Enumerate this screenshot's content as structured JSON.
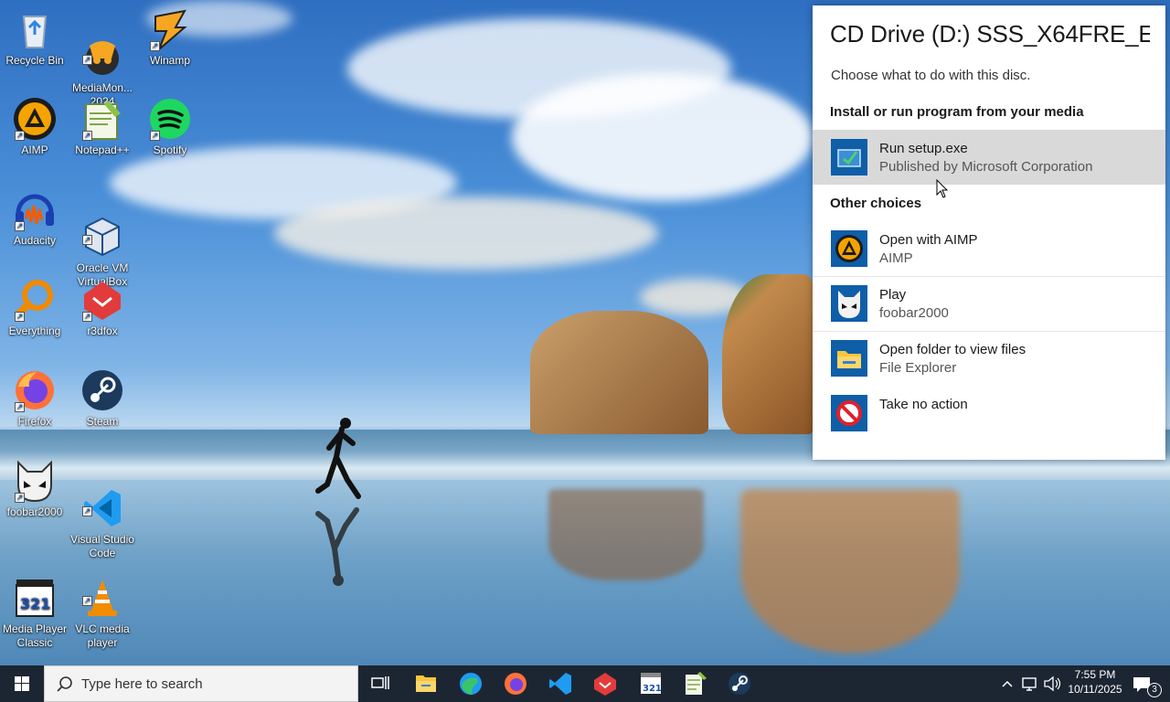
{
  "desktop": {
    "icons": [
      {
        "label": "Recycle Bin",
        "icon": "recycle-bin-icon"
      },
      {
        "label": "MediaMon...\n2024",
        "icon": "mediamonkey-icon"
      },
      {
        "label": "Winamp",
        "icon": "winamp-icon"
      },
      {
        "label": "AIMP",
        "icon": "aimp-icon"
      },
      {
        "label": "Notepad++",
        "icon": "notepad-plus-plus-icon"
      },
      {
        "label": "Spotify",
        "icon": "spotify-icon"
      },
      {
        "label": "Audacity",
        "icon": "audacity-icon"
      },
      {
        "label": "Oracle VM\nVirtualBox",
        "icon": "virtualbox-icon"
      },
      {
        "label": "Everything",
        "icon": "everything-icon"
      },
      {
        "label": "r3dfox",
        "icon": "r3dfox-icon"
      },
      {
        "label": "Firefox",
        "icon": "firefox-icon"
      },
      {
        "label": "Steam",
        "icon": "steam-icon"
      },
      {
        "label": "foobar2000",
        "icon": "foobar2000-icon"
      },
      {
        "label": "Visual Studio\nCode",
        "icon": "vscode-icon"
      },
      {
        "label": "Media Player\nClassic",
        "icon": "mpc-icon"
      },
      {
        "label": "VLC media\nplayer",
        "icon": "vlc-icon"
      }
    ]
  },
  "autoplay": {
    "title": "CD Drive (D:) SSS_X64FRE_E...",
    "subtitle": "Choose what to do with this disc.",
    "section_install": "Install or run program from your media",
    "section_other": "Other choices",
    "run_setup": {
      "title": "Run setup.exe",
      "publisher": "Published by Microsoft Corporation"
    },
    "open_aimp": {
      "title": "Open with AIMP",
      "app": "AIMP"
    },
    "play": {
      "title": "Play",
      "app": "foobar2000"
    },
    "open_folder": {
      "title": "Open folder to view files",
      "app": "File Explorer"
    },
    "no_action": {
      "title": "Take no action"
    }
  },
  "taskbar": {
    "search_placeholder": "Type here to search",
    "time": "7:55 PM",
    "date": "10/11/2025",
    "notification_count": "3",
    "accent": "#0078d4"
  }
}
